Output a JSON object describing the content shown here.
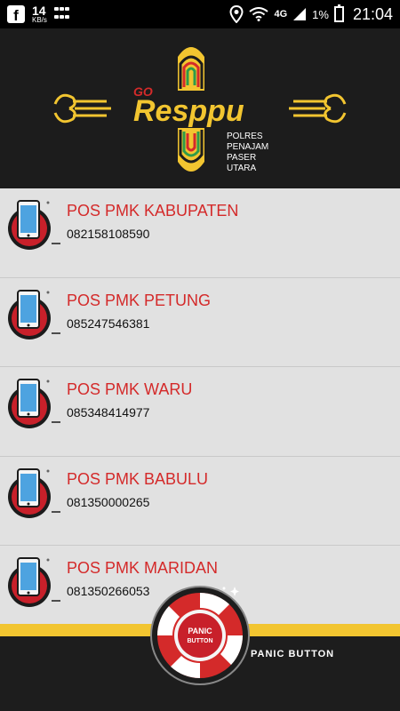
{
  "status_bar": {
    "net_speed": "14",
    "net_unit": "KB/s",
    "network": "4G",
    "battery": "1%",
    "time": "21:04"
  },
  "header": {
    "logo_go": "GO",
    "logo_main": "Resppu",
    "org_line1": "POLRES",
    "org_line2": "PENAJAM",
    "org_line3": "PASER",
    "org_line4": "UTARA"
  },
  "contacts": [
    {
      "name": "POS PMK KABUPATEN",
      "phone": "082158108590"
    },
    {
      "name": "POS PMK PETUNG",
      "phone": "085247546381"
    },
    {
      "name": "POS PMK WARU",
      "phone": "085348414977"
    },
    {
      "name": "POS PMK BABULU",
      "phone": "081350000265"
    },
    {
      "name": "POS PMK MARIDAN",
      "phone": "081350266053"
    }
  ],
  "panic": {
    "badge_line1": "PANIC",
    "badge_line2": "BUTTON",
    "label": "PANIC BUTTON"
  },
  "colors": {
    "accent_red": "#d42a2a",
    "gold": "#f2c530",
    "dark": "#1c1c1c",
    "list_bg": "#e1e1e1"
  }
}
